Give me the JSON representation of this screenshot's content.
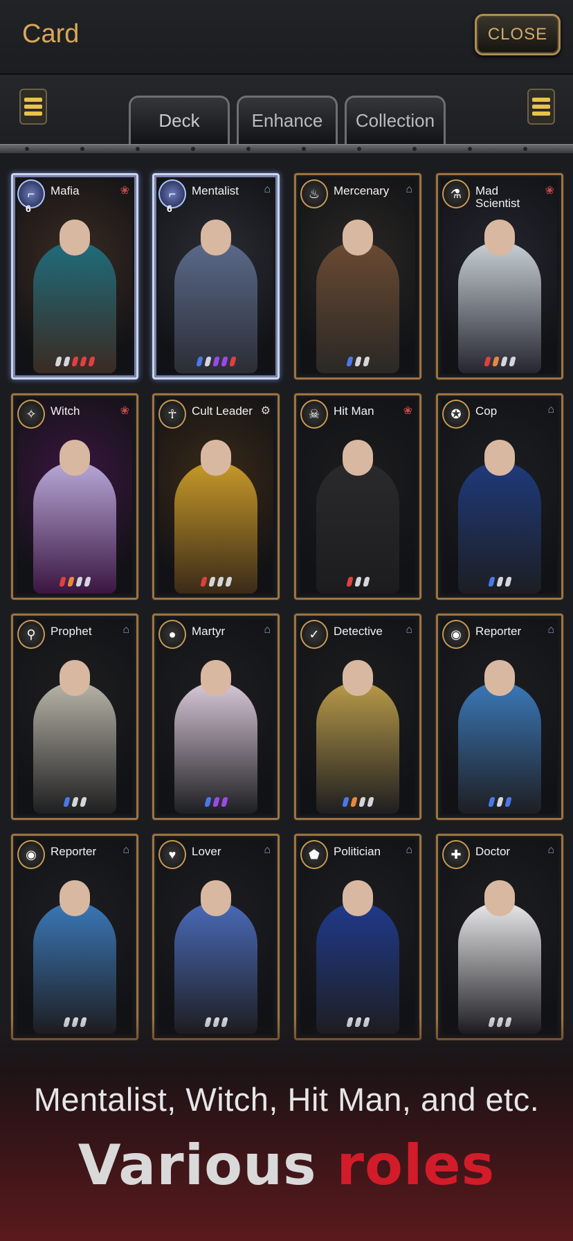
{
  "header": {
    "title": "Card",
    "close_label": "CLOSE"
  },
  "tabs": [
    {
      "label": "Deck",
      "active": true
    },
    {
      "label": "Enhance",
      "active": false
    },
    {
      "label": "Collection",
      "active": false
    }
  ],
  "cards": [
    {
      "name": "Mafia",
      "level": "6",
      "holo": true,
      "icon": "gun-icon",
      "faction": "mafia",
      "art": [
        "#3a2a22",
        "#1f6d7c"
      ],
      "pips": [
        "white",
        "white",
        "red",
        "red",
        "red"
      ]
    },
    {
      "name": "Mentalist",
      "level": "6",
      "holo": true,
      "icon": "gun-icon",
      "faction": "citizen",
      "art": [
        "#2b2d35",
        "#5a6a8a"
      ],
      "pips": [
        "blue",
        "white",
        "purple",
        "purple",
        "red"
      ]
    },
    {
      "name": "Mercenary",
      "level": "",
      "holo": false,
      "icon": "fire-icon",
      "faction": "citizen",
      "art": [
        "#2a2825",
        "#6a4a32"
      ],
      "pips": [
        "blue",
        "white",
        "white"
      ]
    },
    {
      "name": "Mad Scientist",
      "level": "",
      "holo": false,
      "icon": "flask-icon",
      "faction": "mafia",
      "art": [
        "#252530",
        "#c8d0d4"
      ],
      "pips": [
        "red",
        "orange",
        "white",
        "white"
      ]
    },
    {
      "name": "Witch",
      "level": "",
      "holo": false,
      "icon": "wand-icon",
      "faction": "mafia",
      "art": [
        "#3a1640",
        "#b8a8d8"
      ],
      "pips": [
        "red",
        "orange",
        "white",
        "white"
      ]
    },
    {
      "name": "Cult Leader",
      "level": "",
      "holo": false,
      "icon": "ankh-icon",
      "faction": "cult",
      "art": [
        "#3a2a18",
        "#c89a2a"
      ],
      "pips": [
        "red",
        "white",
        "white",
        "white"
      ]
    },
    {
      "name": "Hit Man",
      "level": "",
      "holo": false,
      "icon": "skull-icon",
      "faction": "mafia",
      "art": [
        "#1c1c1e",
        "#2a2a2c"
      ],
      "pips": [
        "red",
        "white",
        "white"
      ]
    },
    {
      "name": "Cop",
      "level": "",
      "holo": false,
      "icon": "badge-icon",
      "faction": "citizen",
      "art": [
        "#1c1e22",
        "#1f3a7c"
      ],
      "pips": [
        "blue",
        "white",
        "white"
      ]
    },
    {
      "name": "Prophet",
      "level": "",
      "holo": false,
      "icon": "staff-icon",
      "faction": "citizen",
      "art": [
        "#1e1e20",
        "#b8b4a8"
      ],
      "pips": [
        "blue",
        "white",
        "white"
      ]
    },
    {
      "name": "Martyr",
      "level": "",
      "holo": false,
      "icon": "bomb-icon",
      "faction": "citizen",
      "art": [
        "#1e1e22",
        "#d8c8d8"
      ],
      "pips": [
        "blue",
        "purple",
        "purple"
      ]
    },
    {
      "name": "Detective",
      "level": "",
      "holo": false,
      "icon": "pipe-icon",
      "faction": "citizen",
      "art": [
        "#1e1e20",
        "#b89a48"
      ],
      "pips": [
        "blue",
        "orange",
        "white",
        "white"
      ]
    },
    {
      "name": "Reporter",
      "level": "",
      "holo": false,
      "icon": "camera-icon",
      "faction": "citizen",
      "art": [
        "#1e1e22",
        "#3a78b8"
      ],
      "pips": [
        "blue",
        "white",
        "blue"
      ]
    },
    {
      "name": "Reporter",
      "level": "",
      "holo": false,
      "icon": "camera-icon",
      "faction": "citizen",
      "art": [
        "#1e1e22",
        "#3a78b8"
      ],
      "pips": [
        "white",
        "white",
        "white"
      ]
    },
    {
      "name": "Lover",
      "level": "",
      "holo": false,
      "icon": "heart-icon",
      "faction": "citizen",
      "art": [
        "#1e1e22",
        "#4a6ab8"
      ],
      "pips": [
        "white",
        "white",
        "white"
      ]
    },
    {
      "name": "Politician",
      "level": "",
      "holo": false,
      "icon": "podium-icon",
      "faction": "citizen",
      "art": [
        "#1e1e22",
        "#1f3a8c"
      ],
      "pips": [
        "white",
        "white",
        "white"
      ]
    },
    {
      "name": "Doctor",
      "level": "",
      "holo": false,
      "icon": "cross-icon",
      "faction": "citizen",
      "art": [
        "#1e1e22",
        "#e8e8ea"
      ],
      "pips": [
        "white",
        "white",
        "white"
      ]
    }
  ],
  "promo": {
    "subtitle": "Mentalist, Witch, Hit Man, and etc.",
    "title_word_1": "Various",
    "title_word_2": "roles"
  }
}
